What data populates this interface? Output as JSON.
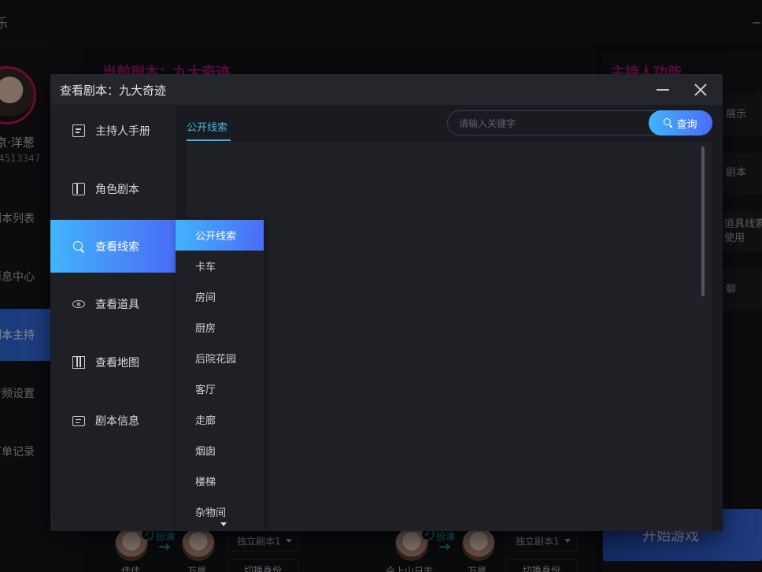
{
  "app": {
    "title": "乐"
  },
  "user": {
    "name": "京·洋葱",
    "id": "4513347"
  },
  "side_menu": [
    {
      "label": "剧本列表",
      "active": false
    },
    {
      "label": "消息中心",
      "active": false
    },
    {
      "label": "剧本主持",
      "active": true
    },
    {
      "label": "音频设置",
      "active": false
    },
    {
      "label": "订单记录",
      "active": false
    }
  ],
  "main": {
    "heading": "当前剧本：九大奇迹"
  },
  "right": {
    "heading": "主持人功能",
    "buttons": [
      "展示",
      "剧本",
      "道具线索",
      "使用",
      "聊"
    ],
    "start_label": "开始游戏"
  },
  "players": [
    {
      "name": "佳佳",
      "role": "扮演",
      "target": "万晨",
      "script": "独立剧本1",
      "switch": "切换身份"
    },
    {
      "name": "今上山日志",
      "role": "扮演",
      "target": "万晨",
      "script": "独立剧本1",
      "switch": "切换身份"
    }
  ],
  "modal": {
    "title": "查看剧本：九大奇迹",
    "nav": [
      {
        "label": "主持人手册",
        "icon": "handbook-icon"
      },
      {
        "label": "角色剧本",
        "icon": "book-icon"
      },
      {
        "label": "查看线索",
        "icon": "search-icon",
        "active": true
      },
      {
        "label": "查看道具",
        "icon": "eye-icon"
      },
      {
        "label": "查看地图",
        "icon": "map-icon"
      },
      {
        "label": "剧本信息",
        "icon": "info-icon"
      }
    ],
    "sub_menu": [
      "公开线索",
      "卡车",
      "房间",
      "厨房",
      "后院花园",
      "客厅",
      "走廊",
      "烟囱",
      "楼梯",
      "杂物间"
    ],
    "tab": "公开线索",
    "search": {
      "placeholder": "请输入关键字",
      "button": "查询"
    }
  }
}
